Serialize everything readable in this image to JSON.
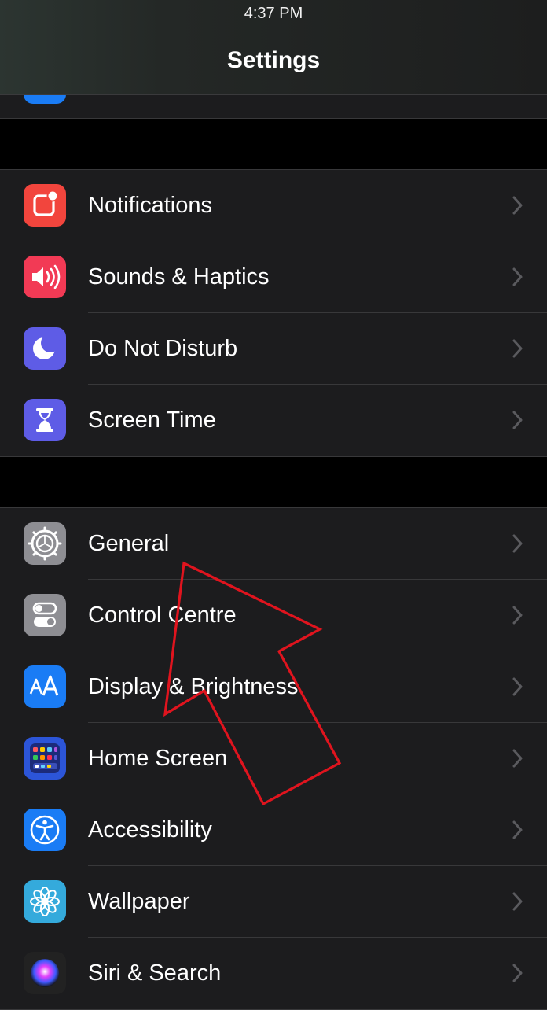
{
  "status_bar": {
    "time": "4:37 PM"
  },
  "nav": {
    "title": "Settings"
  },
  "colors": {
    "background": "#000000",
    "cell": "#1c1c1e",
    "separator": "#38383a",
    "chevron": "#5a5a5e",
    "annotation": "#e0141e"
  },
  "groups": [
    {
      "items": [
        {
          "label": "Notifications",
          "icon": "notifications-icon",
          "color": "#f2453d"
        },
        {
          "label": "Sounds & Haptics",
          "icon": "speaker-icon",
          "color": "#f23a55"
        },
        {
          "label": "Do Not Disturb",
          "icon": "moon-icon",
          "color": "#5e5ce6"
        },
        {
          "label": "Screen Time",
          "icon": "hourglass-icon",
          "color": "#5e5ce6"
        }
      ]
    },
    {
      "items": [
        {
          "label": "General",
          "icon": "gear-icon",
          "color": "#8e8e93"
        },
        {
          "label": "Control Centre",
          "icon": "toggles-icon",
          "color": "#8e8e93"
        },
        {
          "label": "Display & Brightness",
          "icon": "text-size-icon",
          "color": "#1a7cf5"
        },
        {
          "label": "Home Screen",
          "icon": "app-grid-icon",
          "color": "#2c55d8"
        },
        {
          "label": "Accessibility",
          "icon": "accessibility-icon",
          "color": "#1a7cf5"
        },
        {
          "label": "Wallpaper",
          "icon": "flower-icon",
          "color": "#34aadc"
        },
        {
          "label": "Siri & Search",
          "icon": "siri-icon",
          "color": "#222222"
        }
      ]
    }
  ]
}
